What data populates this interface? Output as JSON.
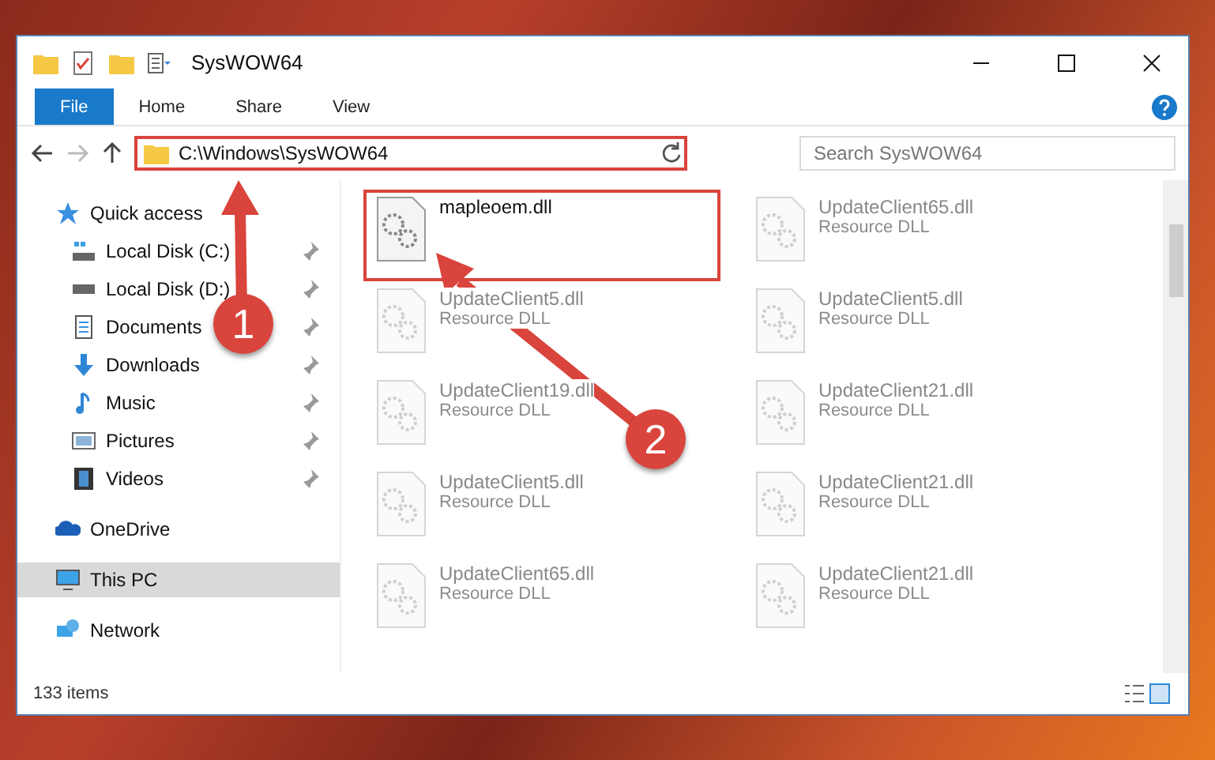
{
  "window": {
    "title": "SysWOW64"
  },
  "ribbon": {
    "tabs": [
      {
        "label": "File",
        "selected": true
      },
      {
        "label": "Home",
        "selected": false
      },
      {
        "label": "Share",
        "selected": false
      },
      {
        "label": "View",
        "selected": false
      }
    ]
  },
  "address": {
    "path": "C:\\Windows\\SysWOW64",
    "highlighted": true
  },
  "search": {
    "placeholder": "Search SysWOW64"
  },
  "sidebar": {
    "items": [
      {
        "kind": "quick",
        "label": "Quick access",
        "selected": false,
        "children": [
          {
            "kind": "drive-c",
            "label": "Local Disk (C:)",
            "pinned": true
          },
          {
            "kind": "drive",
            "label": "Local Disk (D:)",
            "pinned": true
          },
          {
            "kind": "documents",
            "label": "Documents",
            "pinned": true
          },
          {
            "kind": "downloads",
            "label": "Downloads",
            "pinned": true
          },
          {
            "kind": "music",
            "label": "Music",
            "pinned": true
          },
          {
            "kind": "pictures",
            "label": "Pictures",
            "pinned": true
          },
          {
            "kind": "videos",
            "label": "Videos",
            "pinned": true
          }
        ]
      },
      {
        "kind": "onedrive",
        "label": "OneDrive",
        "selected": false
      },
      {
        "kind": "pc",
        "label": "This PC",
        "selected": true
      },
      {
        "kind": "network",
        "label": "Network",
        "selected": false
      }
    ]
  },
  "files": [
    {
      "name": "mapleoem.dll",
      "highlighted": true,
      "faded": false
    },
    {
      "name": "UpdateClient65.dll",
      "type": "Resource DLL",
      "highlighted": false,
      "faded": true
    },
    {
      "name": "UpdateClient5.dll",
      "type": "Resource DLL",
      "highlighted": false,
      "faded": true
    },
    {
      "name": "UpdateClient5.dll",
      "type": "Resource DLL",
      "highlighted": false,
      "faded": true
    },
    {
      "name": "UpdateClient19.dll",
      "type": "Resource DLL",
      "highlighted": false,
      "faded": true
    },
    {
      "name": "UpdateClient21.dll",
      "type": "Resource DLL",
      "highlighted": false,
      "faded": true
    },
    {
      "name": "UpdateClient5.dll",
      "type": "Resource DLL",
      "highlighted": false,
      "faded": true
    },
    {
      "name": "UpdateClient21.dll",
      "type": "Resource DLL",
      "highlighted": false,
      "faded": true
    },
    {
      "name": "UpdateClient65.dll",
      "type": "Resource DLL",
      "highlighted": false,
      "faded": true
    },
    {
      "name": "UpdateClient21.dll",
      "type": "Resource DLL",
      "highlighted": false,
      "faded": true
    }
  ],
  "status_bar": {
    "count": "133 items"
  },
  "annotations": [
    {
      "number": "1"
    },
    {
      "number": "2"
    }
  ]
}
